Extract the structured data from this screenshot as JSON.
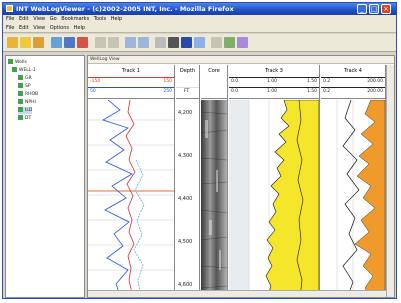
{
  "window": {
    "title": "INT WebLogViewer - (c)2002-2005 INT, Inc. - Mozilla Firefox",
    "buttons": [
      "_",
      "□",
      "×"
    ]
  },
  "browser_menu": [
    "File",
    "Edit",
    "View",
    "Go",
    "Bookmarks",
    "Tools",
    "Help"
  ],
  "app_menu": [
    "File",
    "Edit",
    "View",
    "Options",
    "Help"
  ],
  "toolbar": {
    "icons": [
      "open-icon",
      "save-icon",
      "print-icon",
      "back-icon",
      "chart-icon",
      "export-icon",
      "copy-icon",
      "paste-icon",
      "zoom-in-icon",
      "zoom-out-icon",
      "ruler-icon",
      "track-icon",
      "grid-icon",
      "layout-icon",
      "table-icon",
      "info-icon",
      "help-icon"
    ]
  },
  "tree": {
    "items": [
      {
        "label": "Wells",
        "indent": 0
      },
      {
        "label": "WELL-1",
        "indent": 1
      },
      {
        "label": "GR",
        "indent": 2
      },
      {
        "label": "SP",
        "indent": 2
      },
      {
        "label": "RHOB",
        "indent": 2
      },
      {
        "label": "NPHI",
        "indent": 2
      },
      {
        "label": "ILD",
        "indent": 2
      },
      {
        "label": "DT",
        "indent": 2
      }
    ],
    "selected_index": 6
  },
  "log_view": {
    "tab": "WellLog View",
    "tracks": [
      {
        "name": "Track 1"
      },
      {
        "name": "Depth"
      },
      {
        "name": "Core"
      },
      {
        "name": "Track 3"
      },
      {
        "name": "Track 4"
      }
    ],
    "track1_scales": [
      {
        "left": "-150",
        "right": "150",
        "color": "#e53434"
      },
      {
        "left": "50",
        "right": "250",
        "color": "#2850d6"
      }
    ],
    "depth_unit": "FT",
    "track3_scales": [
      {
        "left": "0.0",
        "right": "1.00",
        "extra": "1.50"
      },
      {
        "left": "0.0",
        "right": "1.00",
        "extra": "1.50"
      }
    ],
    "track4_scales": [
      {
        "left": "0.2",
        "right": "200.00"
      },
      {
        "left": "0.2",
        "right": "200.00"
      }
    ],
    "depth_labels": [
      "4,200",
      "4,300",
      "4,400",
      "4,500",
      "4,600"
    ]
  }
}
